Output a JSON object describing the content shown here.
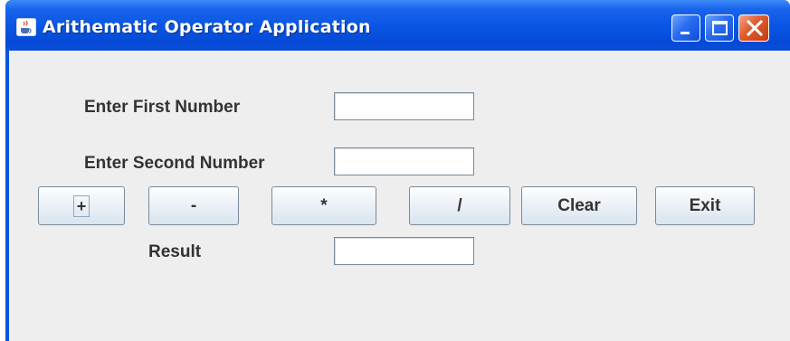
{
  "window": {
    "title": "Arithematic Operator Application",
    "colors": {
      "titlebar": "#0a56e4",
      "frame": "#0a53de",
      "close_button": "#e05a2d",
      "panel_background": "#eeeeee"
    }
  },
  "form": {
    "first_number": {
      "label": "Enter First Number",
      "value": ""
    },
    "second_number": {
      "label": "Enter Second Number",
      "value": ""
    },
    "result": {
      "label": "Result",
      "value": ""
    }
  },
  "buttons": {
    "add": "+",
    "subtract": "-",
    "multiply": "*",
    "divide": "/",
    "clear": "Clear",
    "exit": "Exit"
  },
  "icons": {
    "app": "java-coffee-cup-icon",
    "minimize": "minimize-icon",
    "maximize": "maximize-icon",
    "close": "close-icon"
  }
}
